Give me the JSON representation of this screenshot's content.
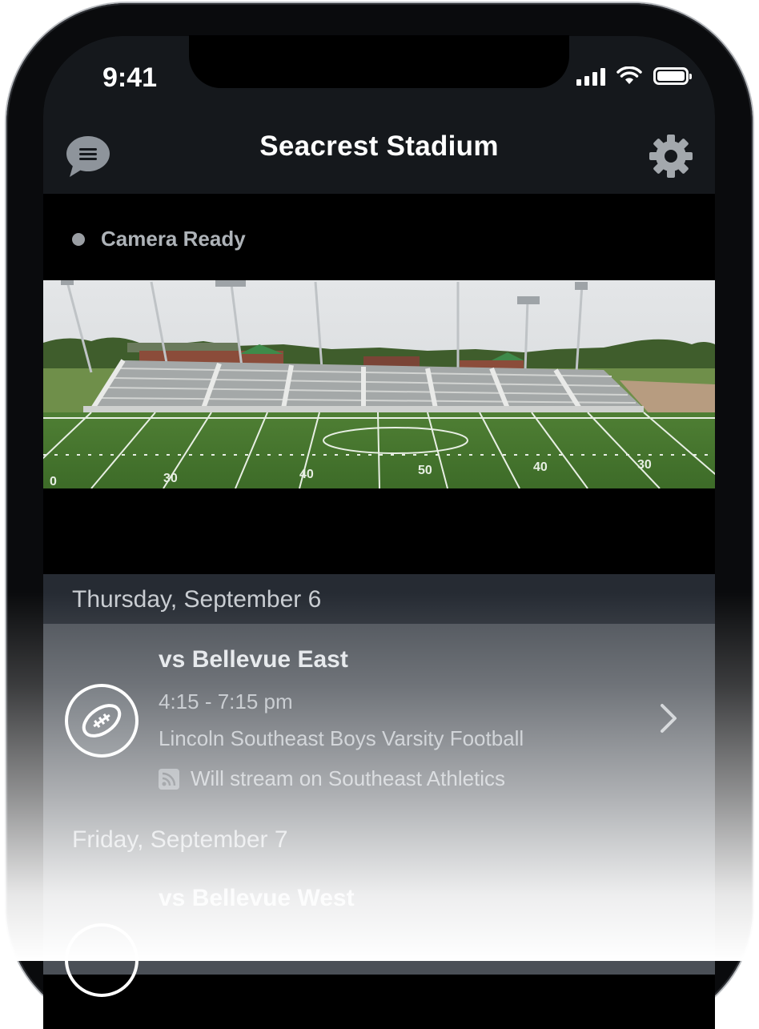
{
  "status_bar": {
    "time": "9:41"
  },
  "header": {
    "title": "Seacrest Stadium",
    "left_icon": "chat-bubble-icon",
    "right_icon": "gear-icon"
  },
  "camera": {
    "status": "Camera Ready",
    "yard_markers": [
      "0",
      "30",
      "40",
      "50",
      "40",
      "30"
    ]
  },
  "schedule": {
    "days": [
      {
        "date": "Thursday, September 6",
        "events": [
          {
            "title": "vs Bellevue East",
            "time": "4:15 - 7:15 pm",
            "team": "Lincoln Southeast Boys Varsity Football",
            "stream": "Will stream on Southeast Athletics",
            "icon": "football-icon"
          }
        ]
      },
      {
        "date": "Friday, September 7",
        "events": [
          {
            "title": "vs Bellevue West",
            "icon": "football-icon"
          }
        ]
      }
    ]
  },
  "colors": {
    "header_bg": "#15181c",
    "date_header_bg": "#262b33",
    "list_bg": "#4b5057"
  }
}
